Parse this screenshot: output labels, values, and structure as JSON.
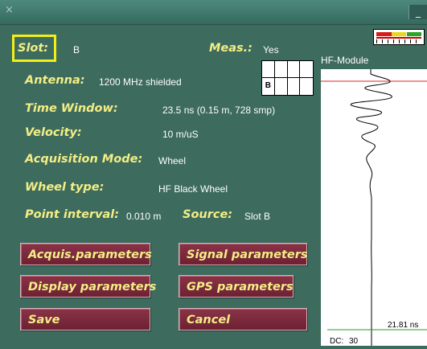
{
  "window": {
    "close_glyph": "×",
    "minimize_glyph": "_"
  },
  "form": {
    "slot_label": "Slot:",
    "slot_value": "B",
    "meas_label": "Meas.:",
    "meas_value": "Yes",
    "antenna_label": "Antenna:",
    "antenna_value": "1200 MHz shielded",
    "time_window_label": "Time Window:",
    "time_window_value": "23.5 ns (0.15 m, 728 smp)",
    "velocity_label": "Velocity:",
    "velocity_value": "10 m/uS",
    "acq_mode_label": "Acquisition Mode:",
    "acq_mode_value": "Wheel",
    "wheel_type_label": "Wheel type:",
    "wheel_type_value": "HF Black Wheel",
    "point_interval_label": "Point interval:",
    "point_interval_value": "0.010 m",
    "source_label": "Source:",
    "source_value": "Slot B"
  },
  "slot_grid": {
    "cells": [
      "",
      "",
      "",
      "",
      "B",
      "",
      "",
      ""
    ]
  },
  "buttons": {
    "acquis": "Acquis.parameters",
    "signal": "Signal parameters",
    "display": "Display parameters",
    "gps": "GPS parameters",
    "save": "Save",
    "cancel": "Cancel"
  },
  "scope": {
    "title": "HF-Module",
    "time_marker": "21.81 ns",
    "dc_label": "DC:",
    "dc_value": "30"
  },
  "colors": {
    "background": "#3d6b5e",
    "label": "#f3ee85",
    "button": "#7a283b",
    "highlight": "#f2ef16",
    "red_line": "#e02020",
    "green_line": "#2a9a2a"
  },
  "level_meter": {
    "segments": [
      "red",
      "yellow",
      "green"
    ]
  }
}
